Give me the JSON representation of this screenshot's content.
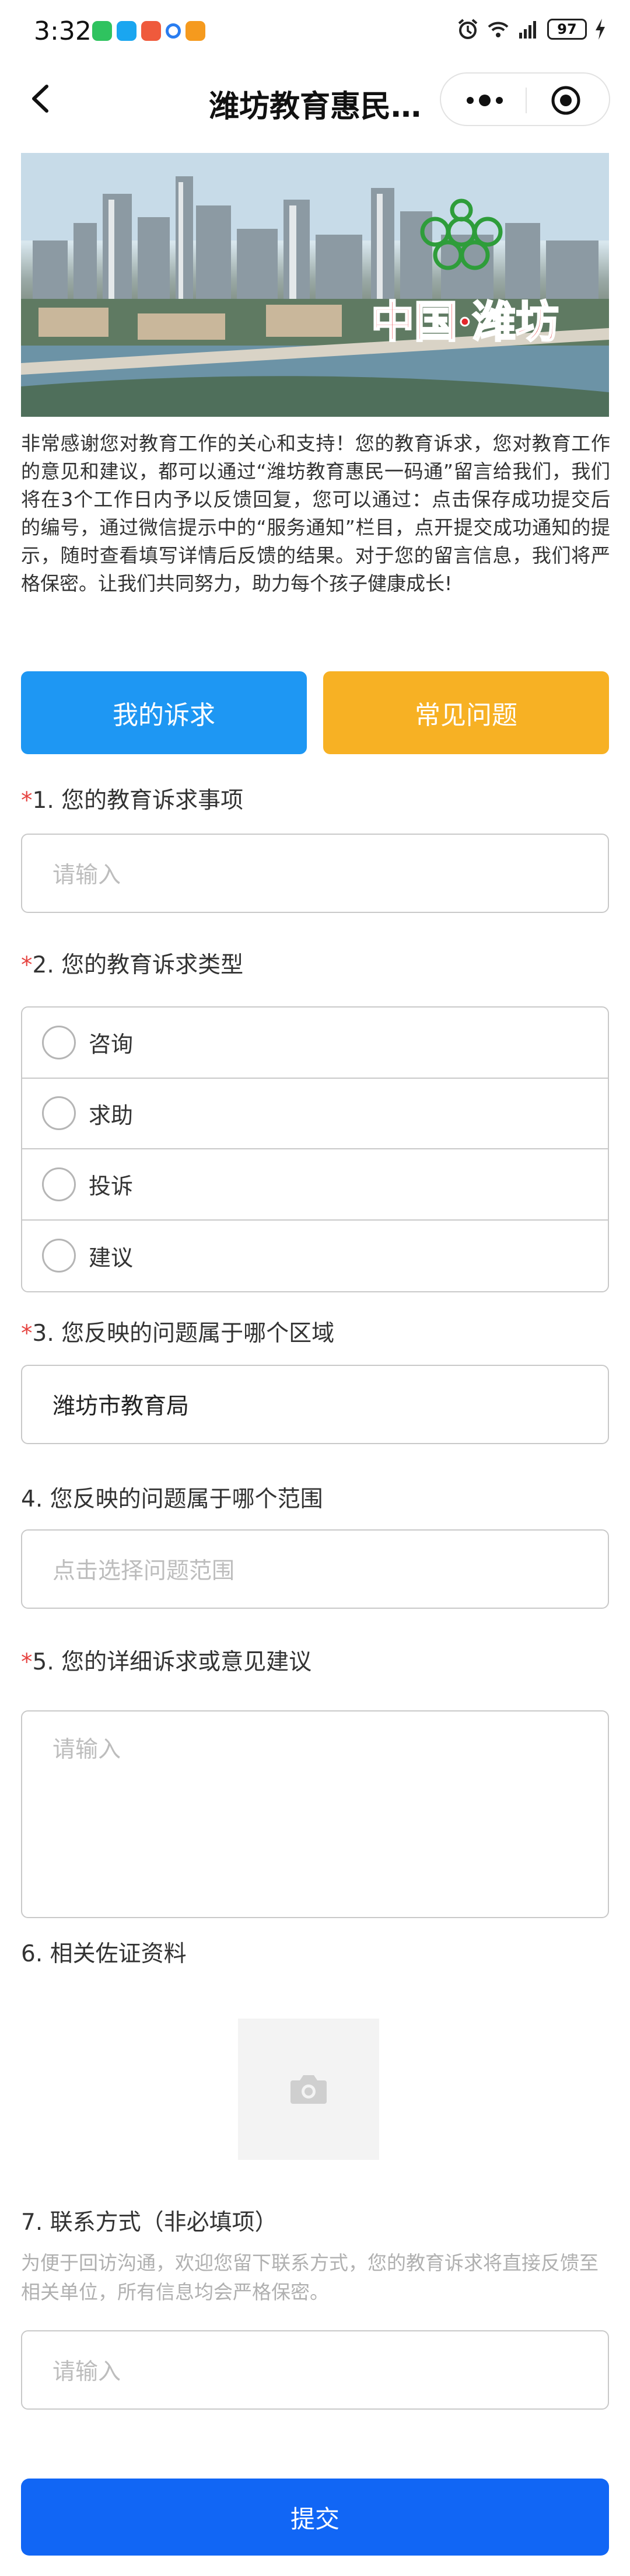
{
  "status_bar": {
    "time": "3:32",
    "battery": "97"
  },
  "nav": {
    "title": "潍坊教育惠民…"
  },
  "banner": {
    "slogan": "中国·潍坊"
  },
  "intro": "非常感谢您对教育工作的关心和支持！您的教育诉求，您对教育工作的意见和建议，都可以通过“潍坊教育惠民一码通”留言给我们，我们将在3个工作日内予以反馈回复，您可以通过：点击保存成功提交后的编号，通过微信提示中的“服务通知”栏目，点开提交成功通知的提示，随时查看填写详情后反馈的结果。对于您的留言信息，我们将严格保密。让我们共同努力，助力每个孩子健康成长!",
  "buttons": {
    "my_appeals": "我的诉求",
    "faq": "常见问题"
  },
  "form": {
    "q1": {
      "required": "*",
      "label": "1. 您的教育诉求事项",
      "placeholder": "请输入"
    },
    "q2": {
      "required": "*",
      "label": "2. 您的教育诉求类型",
      "options": [
        "咨询",
        "求助",
        "投诉",
        "建议"
      ]
    },
    "q3": {
      "required": "*",
      "label": "3. 您反映的问题属于哪个区域",
      "value": "潍坊市教育局"
    },
    "q4": {
      "label": "4. 您反映的问题属于哪个范围",
      "placeholder": "点击选择问题范围"
    },
    "q5": {
      "required": "*",
      "label": "5. 您的详细诉求或意见建议",
      "placeholder": "请输入"
    },
    "q6": {
      "label": "6. 相关佐证资料"
    },
    "q7": {
      "label": "7. 联系方式（非必填项）",
      "hint": "为便于回访沟通，欢迎您留下联系方式，您的教育诉求将直接反馈至相关单位，所有信息均会严格保密。",
      "placeholder": "请输入"
    }
  },
  "submit_label": "提交",
  "colors": {
    "primary_blue": "#1e97f3",
    "accent_yellow": "#f7b124",
    "submit_blue": "#1166f5",
    "required_red": "#e64340"
  }
}
